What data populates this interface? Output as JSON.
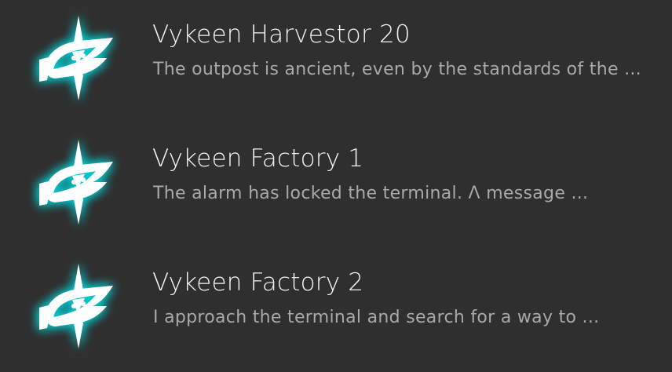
{
  "icons": {
    "entry_icon": "vykeen-eye-icon"
  },
  "colors": {
    "icon_fill": "#ffffff",
    "icon_glow": "#00cfd6",
    "background": "#2f2f2f",
    "title": "#f4f4f4",
    "excerpt": "#a9a9a9"
  },
  "entries": [
    {
      "title": "Vykeen Harvestor 20",
      "excerpt": "The outpost is ancient, even by the standards of the ..."
    },
    {
      "title": "Vykeen Factory 1",
      "excerpt": "The alarm has locked the terminal. Λ message ..."
    },
    {
      "title": "Vykeen Factory 2",
      "excerpt": "I approach the terminal and search for a way to ..."
    }
  ]
}
